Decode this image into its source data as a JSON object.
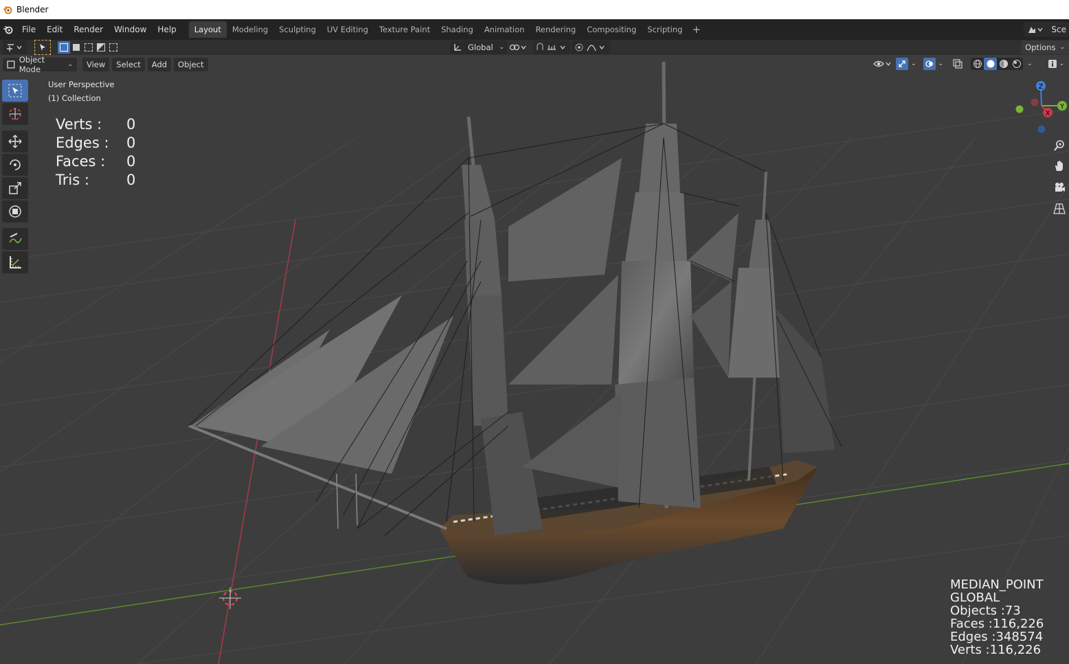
{
  "window": {
    "title": "Blender"
  },
  "menu": [
    "File",
    "Edit",
    "Render",
    "Window",
    "Help"
  ],
  "workspace_tabs": [
    {
      "label": "Layout",
      "active": true
    },
    {
      "label": "Modeling",
      "active": false
    },
    {
      "label": "Sculpting",
      "active": false
    },
    {
      "label": "UV Editing",
      "active": false
    },
    {
      "label": "Texture Paint",
      "active": false
    },
    {
      "label": "Shading",
      "active": false
    },
    {
      "label": "Animation",
      "active": false
    },
    {
      "label": "Rendering",
      "active": false
    },
    {
      "label": "Compositing",
      "active": false
    },
    {
      "label": "Scripting",
      "active": false
    }
  ],
  "add_workspace": "+",
  "scene_label": "Sce",
  "tool_header": {
    "transform_orientation": "Global",
    "options_label": "Options"
  },
  "viewport_header": {
    "mode": "Object Mode",
    "menus": [
      "View",
      "Select",
      "Add",
      "Object"
    ]
  },
  "viewport": {
    "perspective": "User Perspective",
    "collection": "(1) Collection"
  },
  "mesh_stats": {
    "verts_label": "Verts :",
    "verts": "0",
    "edges_label": "Edges :",
    "edges": "0",
    "faces_label": "Faces :",
    "faces": "0",
    "tris_label": "Tris :",
    "tris": "0"
  },
  "scene_stats": {
    "pivot": "MEDIAN_POINT",
    "orientation": "GLOBAL",
    "objects": "Objects :73",
    "faces": "Faces :116,226",
    "edges": "Edges :348574",
    "verts": "Verts :116,226"
  },
  "gizmo": {
    "z": "Z",
    "y": "Y",
    "x": "X"
  },
  "colors": {
    "accent": "#4772b3",
    "x_axis": "#d2394a",
    "y_axis": "#7ab33a",
    "z_axis": "#3f82d9",
    "viewport_bg": "#3d3d3d"
  }
}
